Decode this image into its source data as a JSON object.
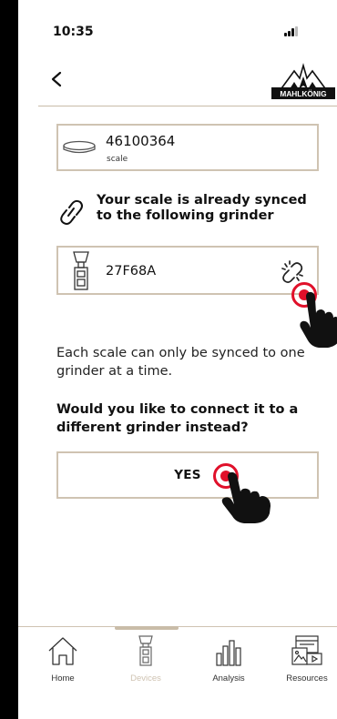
{
  "status_bar": {
    "time": "10:35"
  },
  "header": {
    "brand": "MAHLKÖNIG"
  },
  "scale": {
    "id": "46100364",
    "type_label": "scale"
  },
  "sync_message": {
    "line1": "Your scale is already synced",
    "line2": "to the following grinder"
  },
  "grinder": {
    "id": "27F68A"
  },
  "info": {
    "text": "Each scale can only be synced to one grinder at a time."
  },
  "question": {
    "text": "Would you like to connect it to a different grinder instead?"
  },
  "actions": {
    "yes_label": "YES"
  },
  "nav": {
    "items": [
      {
        "label": "Home",
        "icon": "home-icon",
        "active": false
      },
      {
        "label": "Devices",
        "icon": "grinder-icon",
        "active": true
      },
      {
        "label": "Analysis",
        "icon": "bar-chart-icon",
        "active": false
      },
      {
        "label": "Resources",
        "icon": "resources-icon",
        "active": false
      }
    ]
  },
  "colors": {
    "border": "#cfc3b2",
    "touch": "#e0102a",
    "inactive_nav": "#cfc3b2"
  }
}
